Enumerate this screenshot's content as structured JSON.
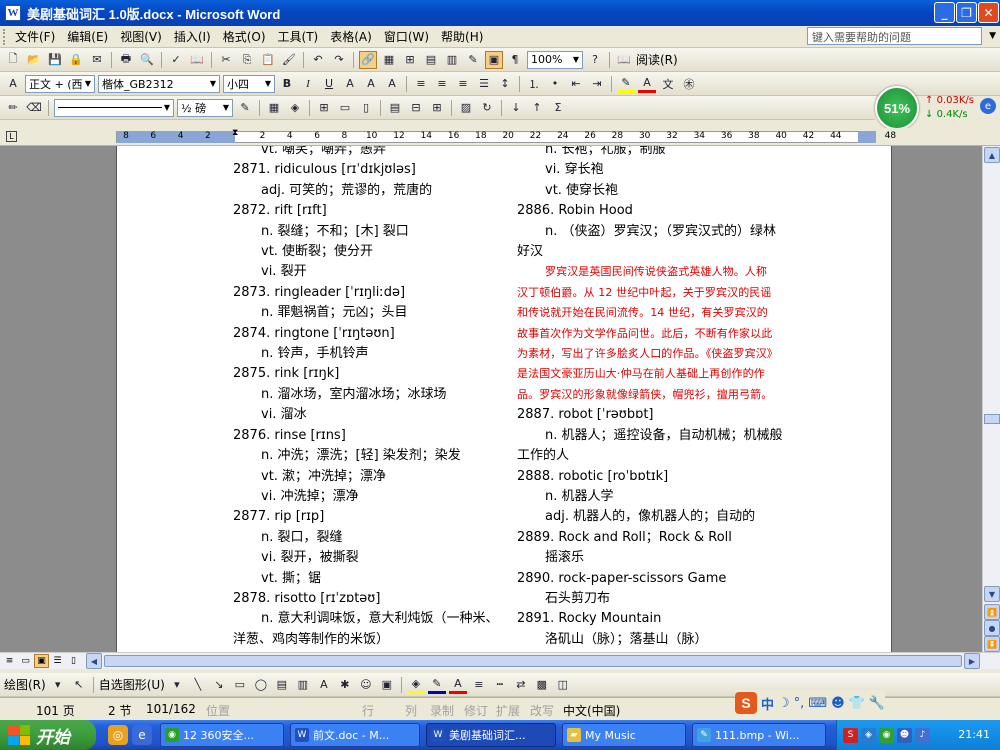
{
  "window": {
    "title": "美剧基础词汇 1.0版.docx - Microsoft Word",
    "app_icon": "W",
    "controls": [
      "_",
      "❐",
      "✕"
    ]
  },
  "menu": {
    "items": [
      "文件(F)",
      "编辑(E)",
      "视图(V)",
      "插入(I)",
      "格式(O)",
      "工具(T)",
      "表格(A)",
      "窗口(W)",
      "帮助(H)"
    ],
    "help_placeholder": "键入需要帮助的问题"
  },
  "toolbar_standard": {
    "zoom": "100%",
    "read_label": "阅读(R)"
  },
  "toolbar_format": {
    "style": "正文 + (西",
    "font": "楷体_GB2312",
    "size": "小四",
    "bold": "B",
    "italic": "I",
    "underline": "U"
  },
  "toolbar_drawing_lines": {
    "line_weight": "½ 磅"
  },
  "network_widget": {
    "percent": "51%",
    "up_speed": "0.03K/s",
    "down_speed": "0.4K/s"
  },
  "ruler": {
    "ticks": [
      "8",
      "6",
      "4",
      "2",
      "",
      "2",
      "4",
      "6",
      "8",
      "10",
      "12",
      "14",
      "16",
      "18",
      "20",
      "22",
      "24",
      "26",
      "28",
      "30",
      "32",
      "34",
      "36",
      "38",
      "40",
      "42",
      "44",
      "",
      "48"
    ]
  },
  "document": {
    "col1": [
      {
        "t": "def",
        "text": "vt. 嘲笑；嘲弄；愚弄"
      },
      {
        "t": "hw",
        "text": "2871. ridiculous [rɪˈdɪkjʊləs]"
      },
      {
        "t": "def",
        "text": "adj. 可笑的；荒谬的，荒唐的"
      },
      {
        "t": "hw",
        "text": "2872. rift [rɪft]"
      },
      {
        "t": "def",
        "text": "n. 裂缝；不和；[木] 裂口"
      },
      {
        "t": "def",
        "text": "vt. 使断裂；使分开"
      },
      {
        "t": "def",
        "text": "vi. 裂开"
      },
      {
        "t": "hw",
        "text": "2873. ringleader [ˈrɪŋliːdə]"
      },
      {
        "t": "def",
        "text": "n. 罪魁祸首；元凶；头目"
      },
      {
        "t": "hw",
        "text": "2874. ringtone [ˈrɪŋtəʊn]"
      },
      {
        "t": "def",
        "text": "n. 铃声，手机铃声"
      },
      {
        "t": "hw",
        "text": "2875. rink [rɪŋk]"
      },
      {
        "t": "def",
        "text": "n. 溜冰场，室内溜冰场；冰球场"
      },
      {
        "t": "def",
        "text": "vi. 溜冰"
      },
      {
        "t": "hw",
        "text": "2876. rinse [rɪns]"
      },
      {
        "t": "def",
        "text": "n. 冲洗；漂洗；[轻] 染发剂；染发"
      },
      {
        "t": "def",
        "text": "vt. 漱；冲洗掉；漂净"
      },
      {
        "t": "def",
        "text": "vi. 冲洗掉；漂净"
      },
      {
        "t": "hw",
        "text": "2877. rip [rɪp]"
      },
      {
        "t": "def",
        "text": "n. 裂口，裂缝"
      },
      {
        "t": "def",
        "text": "vi. 裂开，被撕裂"
      },
      {
        "t": "def",
        "text": "vt. 撕；锯"
      },
      {
        "t": "hw",
        "text": "2878. risotto [rɪˈzɒtəʊ]"
      },
      {
        "t": "wrap",
        "text": "n. 意大利调味饭，意大利炖饭（一种米、洋葱、鸡肉等制作的米饭）"
      }
    ],
    "col2": [
      {
        "t": "def",
        "text": "n. 长袍；礼服；制服"
      },
      {
        "t": "def",
        "text": "vi. 穿长袍"
      },
      {
        "t": "def",
        "text": "vt. 使穿长袍"
      },
      {
        "t": "hw",
        "text": "2886. Robin Hood"
      },
      {
        "t": "wrap",
        "text": "n. （侠盗）罗宾汉；（罗宾汉式的）绿林好汉"
      },
      {
        "t": "note",
        "text": "罗宾汉是英国民间传说侠盗式英雄人物。人称汉丁顿伯爵。从 12 世纪中叶起，关于罗宾汉的民谣和传说就开始在民间流传。14 世纪，有关罗宾汉的故事首次作为文学作品问世。此后，不断有作家以此为素材，写出了许多脍炙人口的作品。《侠盗罗宾汉》是法国文豪亚历山大·仲马在前人基础上再创作的作品。罗宾汉的形象就像绿箭侠，帽兜衫，擅用弓箭。"
      },
      {
        "t": "hw",
        "text": "2887. robot [ˈrəʊbɒt]"
      },
      {
        "t": "wrap",
        "text": "n. 机器人；遥控设备，自动机械；机械般工作的人"
      },
      {
        "t": "hw",
        "text": "2888. robotic [roˈbɒtɪk]"
      },
      {
        "t": "def",
        "text": "n. 机器人学"
      },
      {
        "t": "def",
        "text": "adj. 机器人的，像机器人的；自动的"
      },
      {
        "t": "hw",
        "text": "2889. Rock and Roll；Rock & Roll"
      },
      {
        "t": "def",
        "text": "摇滚乐"
      },
      {
        "t": "hw",
        "text": "2890. rock-paper-scissors Game"
      },
      {
        "t": "def",
        "text": "石头剪刀布"
      },
      {
        "t": "hw",
        "text": "2891. Rocky Mountain"
      },
      {
        "t": "def",
        "text": "洛矶山（脉）；落基山（脉）"
      }
    ]
  },
  "drawing_toolbar": {
    "draw_label": "绘图(R)",
    "autoshape_label": "自选图形(U)"
  },
  "status": {
    "page": "101 页",
    "section": "2 节",
    "pages": "101/162",
    "position": "位置",
    "row": "行",
    "col": "列",
    "rec": "录制",
    "trk": "修订",
    "ext": "扩展",
    "ovr": "改写",
    "lang": "中文(中国)"
  },
  "ime": {
    "logo": "S",
    "mode": "中"
  },
  "taskbar": {
    "start": "开始",
    "tasks": [
      "12 360安全...",
      "前文.doc - M...",
      "美剧基础词汇...",
      "My Music",
      "111.bmp - Wi..."
    ],
    "clock": "21:41"
  },
  "colors": {
    "accent": "#0a5fd8",
    "note_red": "#e00000",
    "start_green": "#3a9a3a"
  }
}
